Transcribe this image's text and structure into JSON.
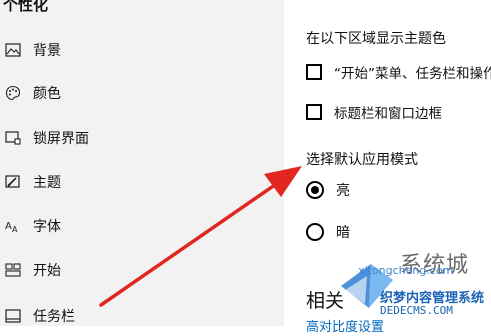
{
  "sidebar": {
    "title": "个性化",
    "items": [
      {
        "label": "背景",
        "icon": "image-icon"
      },
      {
        "label": "颜色",
        "icon": "palette-icon"
      },
      {
        "label": "锁屏界面",
        "icon": "lockscreen-icon"
      },
      {
        "label": "主题",
        "icon": "theme-icon"
      },
      {
        "label": "字体",
        "icon": "font-icon"
      },
      {
        "label": "开始",
        "icon": "start-icon"
      },
      {
        "label": "任务栏",
        "icon": "taskbar-icon"
      }
    ]
  },
  "main": {
    "accent_section_title": "在以下区域显示主题色",
    "accent_options": [
      {
        "label": "“开始”菜单、任务栏和操作",
        "checked": false
      },
      {
        "label": "标题栏和窗口边框",
        "checked": false
      }
    ],
    "mode_section_title": "选择默认应用模式",
    "mode_options": [
      {
        "label": "亮",
        "selected": true
      },
      {
        "label": "暗",
        "selected": false
      }
    ],
    "related_title": "相关",
    "related_link": "高对比度设置"
  },
  "watermark": {
    "brand": "系统城",
    "line1": "织梦内容管理系统",
    "line2": "DEDECMS.COM",
    "line3": "xitongcheng.com"
  },
  "colors": {
    "sidebar_bg": "#f2f2f2",
    "arrow": "#e0261f",
    "link": "#0067c0"
  }
}
